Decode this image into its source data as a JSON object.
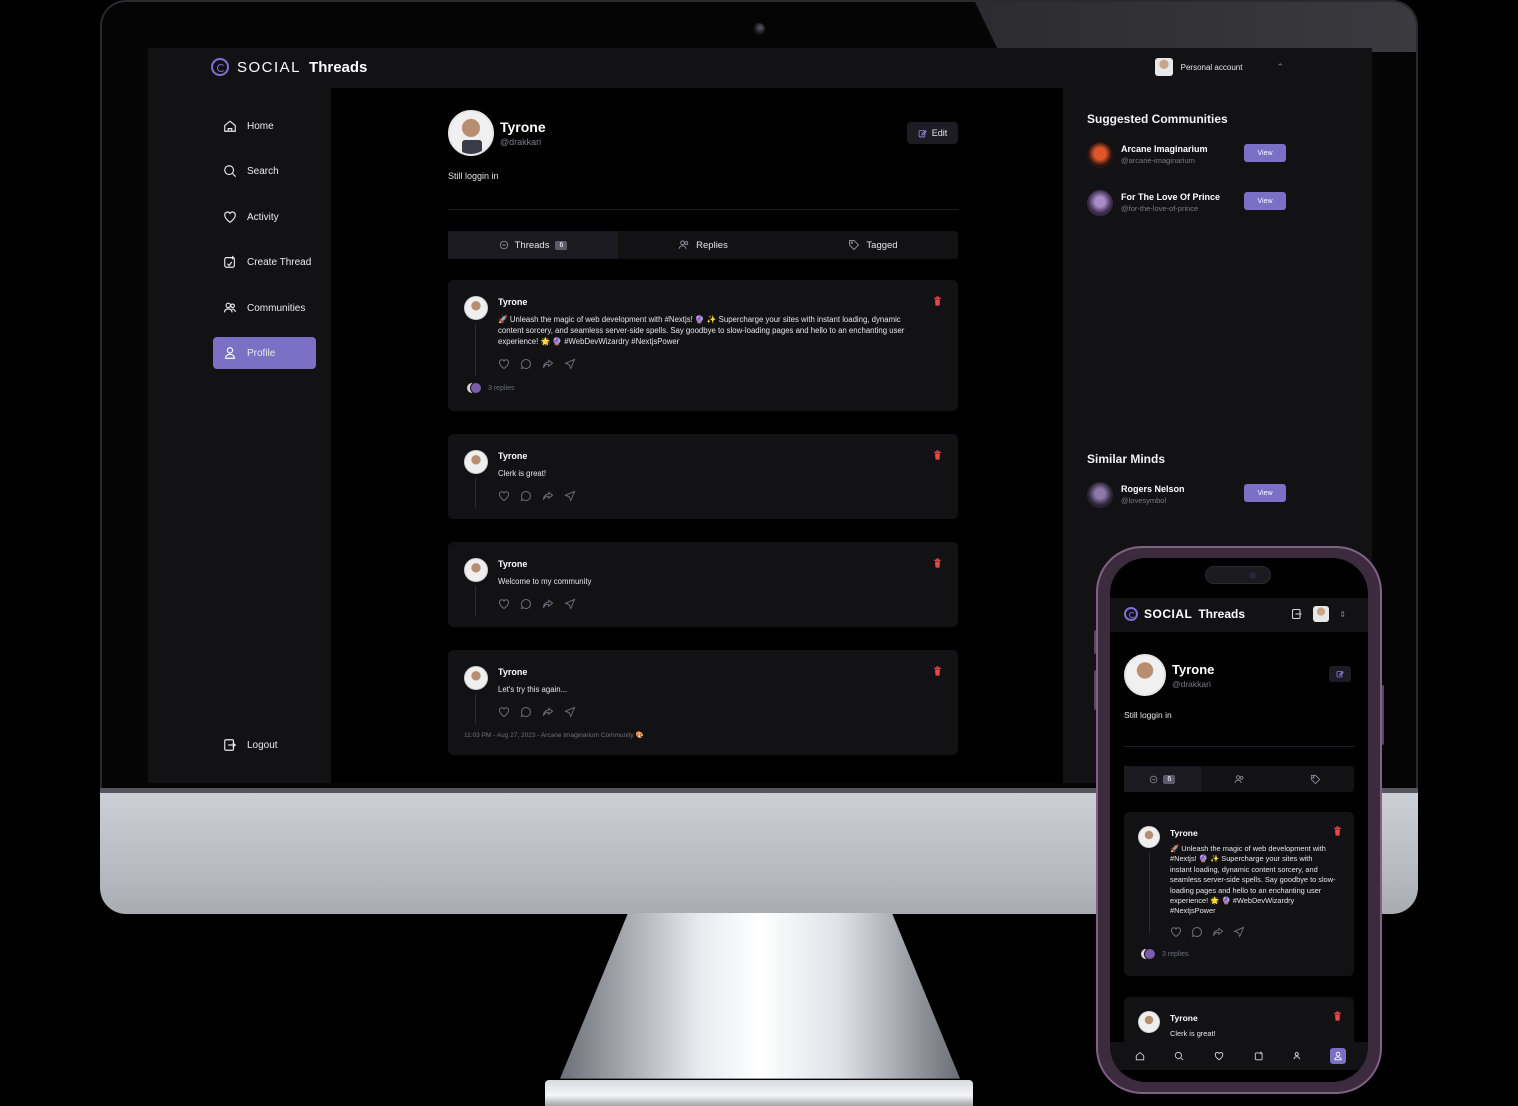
{
  "app": {
    "logo_social": "SOCIAL",
    "logo_threads": "Threads",
    "account_label": "Personal account"
  },
  "sidebar": {
    "items": [
      {
        "label": "Home",
        "icon": "home-icon"
      },
      {
        "label": "Search",
        "icon": "search-icon"
      },
      {
        "label": "Activity",
        "icon": "heart-icon"
      },
      {
        "label": "Create Thread",
        "icon": "create-thread-icon"
      },
      {
        "label": "Communities",
        "icon": "communities-icon"
      },
      {
        "label": "Profile",
        "icon": "profile-icon",
        "active": true
      }
    ],
    "logout_label": "Logout"
  },
  "profile": {
    "name": "Tyrone",
    "handle": "@drakkari",
    "bio": "Still loggin in",
    "edit_label": "Edit"
  },
  "tabs": [
    {
      "label": "Threads",
      "count": "6",
      "active": true
    },
    {
      "label": "Replies"
    },
    {
      "label": "Tagged"
    }
  ],
  "threads": [
    {
      "author": "Tyrone",
      "text": "🚀 Unleash the magic of web development with #Nextjs! 🔮 ✨ Supercharge your sites with instant loading, dynamic content sorcery, and seamless server-side spells. Say goodbye to slow-loading pages and hello to an enchanting user experience! 🌟 🔮 #WebDevWizardry #NextjsPower",
      "replies": "3 replies"
    },
    {
      "author": "Tyrone",
      "text": "Clerk is great!"
    },
    {
      "author": "Tyrone",
      "text": "Welcome to my community"
    },
    {
      "author": "Tyrone",
      "text": "Let's try this again...",
      "meta": "11:03 PM - Aug 27, 2023 - Arcane Imaginarium Community 🎨"
    }
  ],
  "suggested_communities": {
    "title": "Suggested Communities",
    "items": [
      {
        "name": "Arcane Imaginarium",
        "handle": "@arcane-imaginarium",
        "button": "View"
      },
      {
        "name": "For The Love Of Prince",
        "handle": "@for-the-love-of-prince",
        "button": "View"
      }
    ]
  },
  "similar_minds": {
    "title": "Similar Minds",
    "items": [
      {
        "name": "Rogers Nelson",
        "handle": "@lovesymbol",
        "button": "View"
      }
    ]
  },
  "mobile": {
    "logo_social": "SOCIAL",
    "logo_threads": "Threads",
    "name": "Tyrone",
    "handle": "@drakkari",
    "bio": "Still loggin in",
    "threads_count": "6",
    "threads": [
      {
        "author": "Tyrone",
        "text": "🚀 Unleash the magic of web development with #Nextjs! 🔮 ✨ Supercharge your sites with instant loading, dynamic content sorcery, and seamless server-side spells. Say goodbye to slow-loading pages and hello to an enchanting user experience! 🌟 🔮 #WebDevWizardry #NextjsPower",
        "replies": "3 replies"
      },
      {
        "author": "Tyrone",
        "text": "Clerk is great!"
      }
    ]
  },
  "colors": {
    "accent": "#7b6fc6",
    "background": "#000000",
    "panel": "#121215",
    "delete": "#e5484d"
  }
}
